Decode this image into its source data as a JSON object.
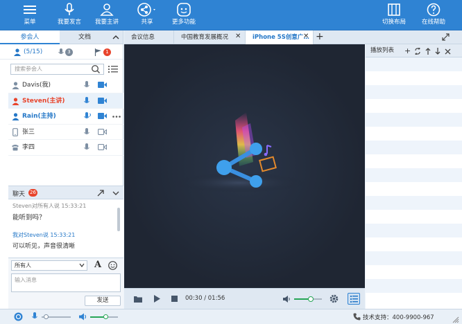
{
  "toolbar": {
    "menu": "菜单",
    "speak": "我要发言",
    "present": "我要主讲",
    "share": "共享",
    "more": "更多功能",
    "layout": "切换布局",
    "help": "在线帮助"
  },
  "left_tabs": {
    "participants": "参会人",
    "docs": "文档"
  },
  "stats": {
    "attendees": "(5/15)",
    "speakers": "3",
    "hands": "1"
  },
  "search": {
    "placeholder": "搜索参会人"
  },
  "participants": [
    {
      "name": "Davis(我)",
      "role": "self",
      "color": "#333333"
    },
    {
      "name": "Steven(主讲)",
      "role": "presenter",
      "color": "#e8442b"
    },
    {
      "name": "Rain(主持)",
      "role": "host",
      "color": "#2477c7"
    },
    {
      "name": "张三",
      "role": "mobile",
      "color": "#333333"
    },
    {
      "name": "李四",
      "role": "phone",
      "color": "#333333"
    }
  ],
  "chat": {
    "title": "聊天",
    "count": "26",
    "messages": [
      {
        "header": "Steven对所有人说  15:33:21",
        "text": "能听到吗？",
        "mine": false
      },
      {
        "header": "我对Steven说  15:33:21",
        "text": "可以听见，声音很清晰",
        "mine": true
      }
    ],
    "recipient": "所有人",
    "input_placeholder": "输入消息",
    "send": "发送"
  },
  "center_tabs": [
    {
      "label": "会议信息",
      "active": false,
      "closable": false
    },
    {
      "label": "中国教育发展概况",
      "active": false,
      "closable": true
    },
    {
      "label": "iPhone 5S创意广…",
      "active": true,
      "closable": true
    }
  ],
  "player": {
    "time": "00:30 / 01:56",
    "volume": 0.6
  },
  "playlist": {
    "title": "播放列表"
  },
  "status": {
    "support": "技术支持：400-9900-967",
    "mic_level": 0.15,
    "speaker_level": 0.55
  },
  "colors": {
    "brand": "#2f83d3",
    "accent": "#e8442b"
  }
}
